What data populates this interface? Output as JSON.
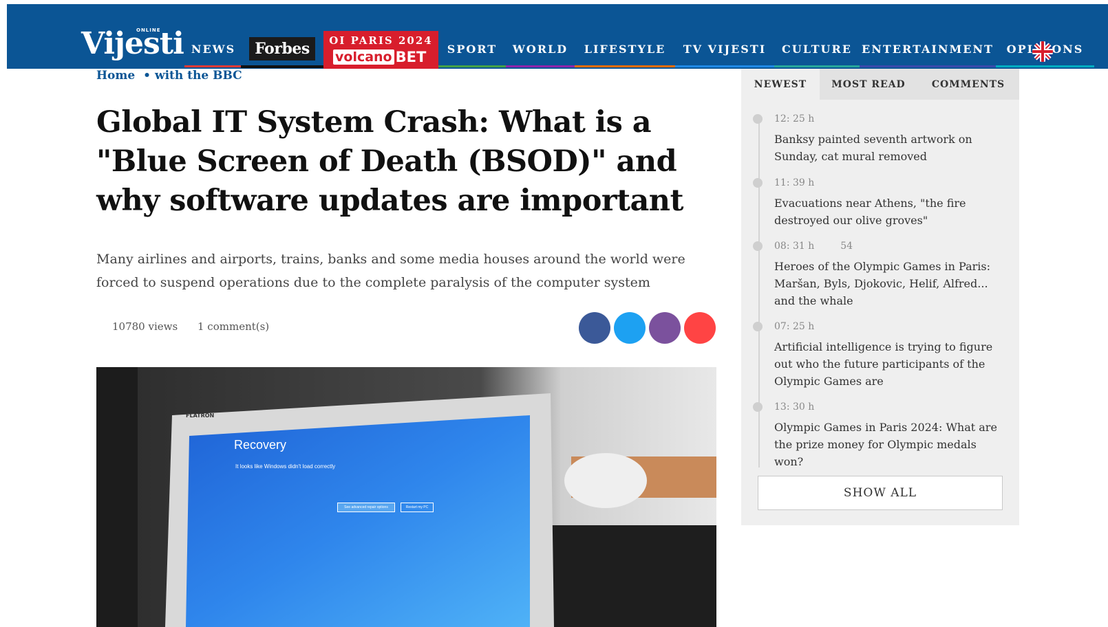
{
  "brand": {
    "logo": "Vijesti",
    "logo_tag": "ONLINE"
  },
  "nav": {
    "news": "NEWS",
    "forbes": "Forbes",
    "promo_line1": "OI PARIS 2024",
    "promo_volcano": "volcano",
    "promo_bet": "BET",
    "sport": "SPORT",
    "world": "WORLD",
    "lifestyle": "LIFESTYLE",
    "tv": "TV VIJESTI",
    "culture": "CULTURE",
    "entertainment": "ENTERTAINMENT",
    "opinions": "OPINIONS"
  },
  "colors": {
    "nav_bg": "#0b5595",
    "news": "#e53935",
    "sport": "#43a047",
    "world": "#8e24aa",
    "lifestyle": "#ef6c00",
    "tv": "#1e88e5",
    "culture": "#26a69a",
    "entertainment": "#3949ab",
    "opinions": "#00acc1",
    "promo": "#d81e2c"
  },
  "breadcrumb": {
    "home": "Home",
    "separator": "•",
    "section": "with the BBC"
  },
  "article": {
    "headline": "Global IT System Crash: What is a \"Blue Screen of Death (BSOD)\" and why software updates are important",
    "lead": "Many airlines and airports, trains, banks and some media houses around the world were forced to suspend operations due to the complete paralysis of the computer system",
    "views": "10780 views",
    "comments": "1 comment(s)",
    "share_icons": [
      "facebook-icon",
      "twitter-icon",
      "viber-icon",
      "email-icon"
    ],
    "share_colors": [
      "#3b5998",
      "#1da1f2",
      "#7b519d",
      "#f44"
    ]
  },
  "photo": {
    "monitor_brand": "FLATRON",
    "screen_title": "Recovery",
    "screen_subtitle": "It looks like Windows didn't load correctly",
    "btn1": "See advanced repair options",
    "btn2": "Restart my PC"
  },
  "sidebar": {
    "tabs": [
      "NEWEST",
      "MOST READ",
      "COMMENTS"
    ],
    "items": [
      {
        "time": "12: 25 h",
        "count": "",
        "title": "Banksy painted seventh artwork on Sunday, cat mural removed"
      },
      {
        "time": "11: 39 h",
        "count": "",
        "title": "Evacuations near Athens, \"the fire destroyed our olive groves\""
      },
      {
        "time": "08: 31 h",
        "count": "54",
        "title": "Heroes of the Olympic Games in Paris: Maršan, Byls, Djokovic, Helif, Alfred... and the whale"
      },
      {
        "time": "07: 25 h",
        "count": "",
        "title": "Artificial intelligence is trying to figure out who the future participants of the Olympic Games are"
      },
      {
        "time": "13: 30 h",
        "count": "",
        "title": "Olympic Games in Paris 2024: What are the prize money for Olympic medals won?"
      }
    ],
    "show_all": "SHOW ALL"
  }
}
